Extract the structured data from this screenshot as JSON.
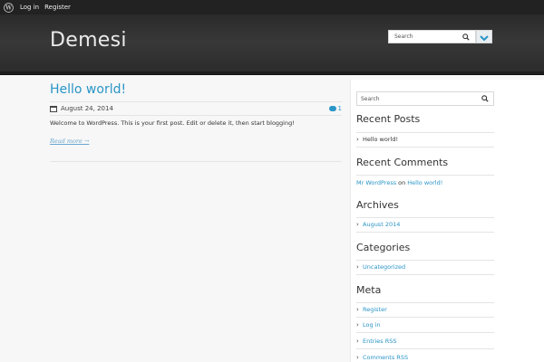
{
  "adminbar": {
    "login": "Log in",
    "register": "Register"
  },
  "header": {
    "site_title": "Demesi",
    "search_placeholder": "Search"
  },
  "post": {
    "title": "Hello world!",
    "date": "August 24, 2014",
    "comment_count": "1",
    "excerpt": "Welcome to WordPress. This is your first post. Edit or delete it, then start blogging!",
    "read_more": "Read more →"
  },
  "sidebar": {
    "search_placeholder": "Search",
    "recent_posts": {
      "title": "Recent Posts",
      "items": [
        "Hello world!"
      ]
    },
    "recent_comments": {
      "title": "Recent Comments",
      "author": "Mr WordPress",
      "on": "on",
      "post": "Hello world!"
    },
    "archives": {
      "title": "Archives",
      "items": [
        "August 2014"
      ]
    },
    "categories": {
      "title": "Categories",
      "items": [
        "Uncategorized"
      ]
    },
    "meta": {
      "title": "Meta",
      "items": [
        "Register",
        "Log in",
        "Entries RSS",
        "Comments RSS"
      ]
    }
  },
  "colors": {
    "link": "#2a95c7",
    "admin_bar": "#222222",
    "header": "#333333",
    "toggle": "#2a95c7"
  }
}
